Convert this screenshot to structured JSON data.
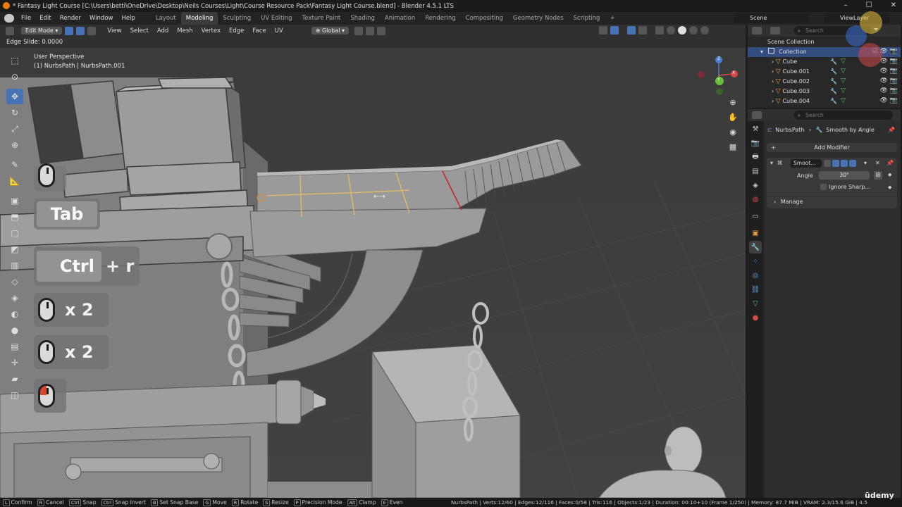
{
  "window": {
    "title": "* Fantasy Light Course [C:\\Users\\betti\\OneDrive\\Desktop\\Neils Courses\\Light\\Course Resource Pack\\Fantasy Light Course.blend] - Blender 4.5.1 LTS",
    "controls": [
      "–",
      "☐",
      "✕"
    ]
  },
  "menubar": {
    "items": [
      "File",
      "Edit",
      "Render",
      "Window",
      "Help"
    ],
    "workspaces": [
      "Layout",
      "Modeling",
      "Sculpting",
      "UV Editing",
      "Texture Paint",
      "Shading",
      "Animation",
      "Rendering",
      "Compositing",
      "Geometry Nodes",
      "Scripting"
    ],
    "active_workspace": "Modeling",
    "add_workspace": "+",
    "scene_label": "Scene",
    "viewlayer_label": "ViewLayer"
  },
  "viewport_header": {
    "mode": "Edit Mode",
    "menus": [
      "View",
      "Select",
      "Add",
      "Mesh",
      "Vertex",
      "Edge",
      "Face",
      "UV"
    ],
    "transform_orientation": "Global"
  },
  "operator_status": "Edge Slide: 0.0000",
  "viewport": {
    "perspective": "User Perspective",
    "object_info": "(1) NurbsPath | NurbsPath.001",
    "slide_cursor": "←→"
  },
  "gizmo": {
    "x": "X",
    "y": "Y",
    "z": "Z"
  },
  "key_overlay": {
    "tab": "Tab",
    "ctrl": "Ctrl",
    "plus_r": "+ r",
    "times_two": "x 2"
  },
  "outliner": {
    "search_placeholder": "Search",
    "scene_collection": "Scene Collection",
    "collection": "Collection",
    "objects": [
      "Cube",
      "Cube.001",
      "Cube.002",
      "Cube.003",
      "Cube.004"
    ]
  },
  "properties": {
    "search_placeholder": "Search",
    "breadcrumb_object": "NurbsPath",
    "breadcrumb_modifier": "Smooth by Angle",
    "add_modifier": "Add Modifier",
    "modifier_name": "Smoot...",
    "angle_label": "Angle",
    "angle_value": "30°",
    "ignore_sharp": "Ignore Sharp...",
    "manage": "Manage"
  },
  "statusbar": {
    "items": [
      {
        "key": "L",
        "label": "Confirm"
      },
      {
        "key": "R",
        "label": "Cancel"
      },
      {
        "key": "Ctrl",
        "label": "Snap"
      },
      {
        "key": "Ctrl",
        "label": "Snap Invert"
      },
      {
        "key": "B",
        "label": "Set Snap Base"
      },
      {
        "key": "G",
        "label": "Move"
      },
      {
        "key": "R",
        "label": "Rotate"
      },
      {
        "key": "S",
        "label": "Resize"
      },
      {
        "key": "P",
        "label": "Precision Mode"
      },
      {
        "key": "Alt",
        "label": "Clamp"
      },
      {
        "key": "E",
        "label": "Even"
      }
    ],
    "stats": "NurbsPath | Verts:12/60 | Edges:12/116 | Faces:0/58 | Tris:116 | Objects:1/23 | Duration: 00:10+10 (Frame 1/250) | Memory: 87.7 MiB | VRAM: 2.3/15.6 GiB | 4.5"
  },
  "watermark": "ūdemy",
  "colors": {
    "accent": "#4772b3",
    "edge_selected": "#e8c060",
    "edge_active": "#d02020",
    "viewport_bg": "#3d3d3d",
    "modifier_orange": "#e3a04a",
    "mesh_green": "#5fbf6a"
  }
}
